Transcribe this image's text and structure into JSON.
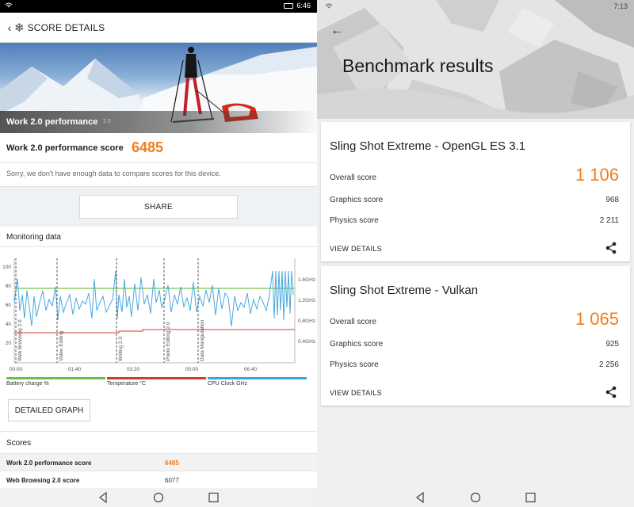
{
  "left": {
    "status_time": "6:46",
    "header_title": "SCORE DETAILS",
    "hero_caption": "Work 2.0 performance",
    "hero_version": "2.0",
    "score_label": "Work 2.0 performance score",
    "score_value": "6485",
    "sorry_text": "Sorry, we don't have enough data to compare scores for this device.",
    "share_label": "SHARE",
    "monitoring_title": "Monitoring data",
    "chart": {
      "y_ticks": [
        "100",
        "80",
        "60",
        "40",
        "20"
      ],
      "right_ticks": [
        "1.6GHz",
        "1.2GHz",
        "0.8GHz",
        "0.4GHz"
      ],
      "x_ticks": [
        "00:00",
        "01:40",
        "03:20",
        "05:00",
        "06:40"
      ],
      "markers": [
        "Web Browsing 2.0",
        "Video Editing",
        "Writing 2.0",
        "Photo Editing 2.0",
        "Data Manipulation"
      ],
      "legend": [
        {
          "label": "Battery charge %",
          "color": "#6cc04a"
        },
        {
          "label": "Temperature °C",
          "color": "#d23b2f"
        },
        {
          "label": "CPU Clock GHz",
          "color": "#3aa4dc"
        }
      ]
    },
    "detailed_graph_label": "DETAILED GRAPH",
    "scores_title": "Scores",
    "scores": [
      {
        "name": "Work 2.0 performance score",
        "value": "6485"
      },
      {
        "name": "Web Browsing 2.0 score",
        "value": "6077"
      }
    ]
  },
  "right": {
    "status_time": "7:13",
    "page_title": "Benchmark results",
    "cards": [
      {
        "title": "Sling Shot Extreme - OpenGL ES 3.1",
        "overall_label": "Overall score",
        "overall_value": "1 106",
        "graphics_label": "Graphics score",
        "graphics_value": "968",
        "physics_label": "Physics score",
        "physics_value": "2 211",
        "details_label": "VIEW DETAILS"
      },
      {
        "title": "Sling Shot Extreme - Vulkan",
        "overall_label": "Overall score",
        "overall_value": "1 065",
        "graphics_label": "Graphics score",
        "graphics_value": "925",
        "physics_label": "Physics score",
        "physics_value": "2 256",
        "details_label": "VIEW DETAILS"
      }
    ]
  },
  "colors": {
    "accent": "#f07e1f"
  },
  "icons": [
    "wifi-icon",
    "back-arrow-icon",
    "snowflake-icon",
    "share-icon",
    "nav-back-icon",
    "nav-home-icon",
    "nav-recents-icon"
  ]
}
